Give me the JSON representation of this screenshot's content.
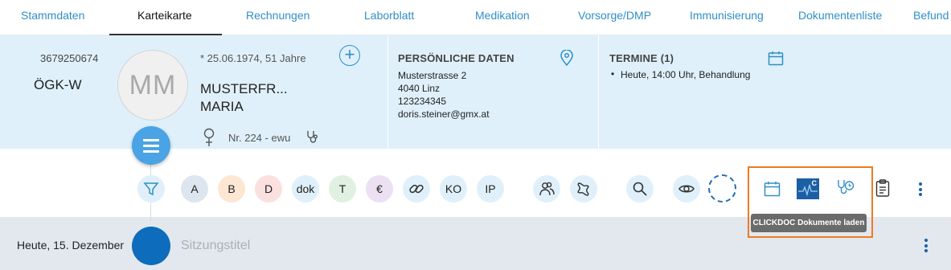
{
  "tabs": [
    {
      "label": "Stammdaten",
      "active": false
    },
    {
      "label": "Karteikarte",
      "active": true
    },
    {
      "label": "Rechnungen",
      "active": false
    },
    {
      "label": "Laborblatt",
      "active": false
    },
    {
      "label": "Medikation",
      "active": false
    },
    {
      "label": "Vorsorge/DMP",
      "active": false
    },
    {
      "label": "Immunisierung",
      "active": false
    },
    {
      "label": "Dokumentenliste",
      "active": false
    },
    {
      "label": "Befund",
      "active": false
    }
  ],
  "patient": {
    "id": "3679250674",
    "insurer": "ÖGK-W",
    "avatar_initials": "MM",
    "dob": "* 25.06.1974, 51 Jahre",
    "last_name": "MUSTERFR...",
    "first_name": "MARIA",
    "gender_symbol": "♀",
    "number": "Nr. 224 - ewu"
  },
  "personal": {
    "title": "PERSÖNLICHE DATEN",
    "street": "Musterstrasse 2",
    "city": "4040 Linz",
    "phone": "123234345",
    "email": "doris.steiner@gmx.at"
  },
  "appointments": {
    "title": "TERMINE (1)",
    "items": [
      "Heute, 14:00 Uhr, Behandlung"
    ]
  },
  "filters": [
    "A",
    "B",
    "D",
    "dok",
    "T",
    "€",
    "KO",
    "IP"
  ],
  "icons": {
    "filter": "filter-icon",
    "link": "link-icon",
    "group": "group-icon",
    "map": "map-icon",
    "search": "search-icon",
    "eye": "eye-icon",
    "calendar": "calendar-icon",
    "clickdoc": "clickdoc-icon",
    "appointment_history": "doctor-clock-icon",
    "clipboard": "clipboard-icon"
  },
  "clickdoc_label": "C",
  "tooltip": "CLICKDOC Dokumente laden",
  "session": {
    "date": "Heute, 15. Dezember",
    "title_placeholder": "Sitzungstitel"
  },
  "colors": {
    "accent": "#2f8fc7",
    "header_bg": "#dff0fa",
    "fab": "#4aa3e4",
    "highlight": "#f07a22",
    "session_bg": "#e2e8ee"
  }
}
